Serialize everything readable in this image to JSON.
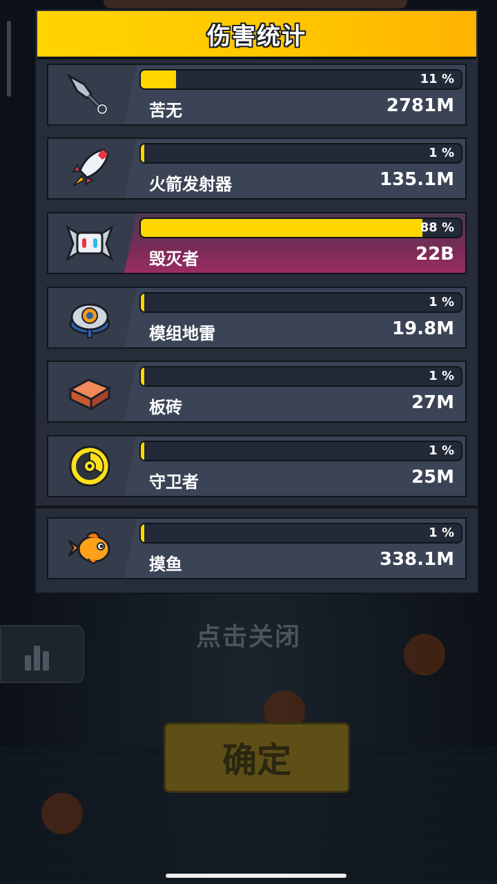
{
  "panel": {
    "title": "伤害统计"
  },
  "rows": [
    {
      "name": "苦无",
      "value": "2781M",
      "percent_label": "11 %",
      "percent": 11,
      "icon": "kunai-icon"
    },
    {
      "name": "火箭发射器",
      "value": "135.1M",
      "percent_label": "1 %",
      "percent": 1,
      "icon": "rocket-icon"
    },
    {
      "name": "毁灭者",
      "value": "22B",
      "percent_label": "88 %",
      "percent": 88,
      "icon": "destroyer-drone-icon",
      "highlight": true
    },
    {
      "name": "模组地雷",
      "value": "19.8M",
      "percent_label": "1 %",
      "percent": 1,
      "icon": "landmine-icon"
    },
    {
      "name": "板砖",
      "value": "27M",
      "percent_label": "1 %",
      "percent": 1,
      "icon": "brick-icon"
    },
    {
      "name": "守卫者",
      "value": "25M",
      "percent_label": "1 %",
      "percent": 1,
      "icon": "guardian-shield-icon"
    }
  ],
  "extra_row": {
    "name": "摸鱼",
    "value": "338.1M",
    "percent_label": "1 %",
    "percent": 1,
    "icon": "goldfish-icon"
  },
  "background": {
    "close_hint": "点击关闭",
    "confirm_label": "确定",
    "stats_icon": "bar-chart-icon"
  },
  "colors": {
    "accent": "#ffd600",
    "header": "#ffc500",
    "panel": "#262c38",
    "highlight": "#9b2c61"
  }
}
